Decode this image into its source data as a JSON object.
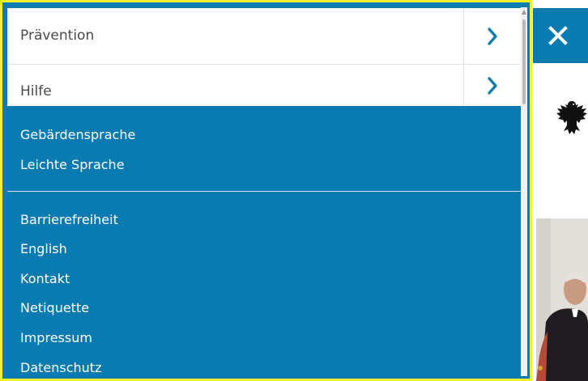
{
  "menu": {
    "items": [
      {
        "label": "Prävention"
      },
      {
        "label": "Hilfe"
      }
    ],
    "language_links": [
      "Gebärdensprache",
      "Leichte Sprache"
    ],
    "footer_links": [
      "Barrierefreiheit",
      "English",
      "Kontakt",
      "Netiquette",
      "Impressum",
      "Datenschutz"
    ]
  },
  "colors": {
    "accent": "#0a7bb1",
    "focus_outline": "#f4ef2d"
  },
  "icons": {
    "close": "close-icon",
    "arrow": "chevron-right-icon",
    "logo": "federal-eagle-icon"
  }
}
